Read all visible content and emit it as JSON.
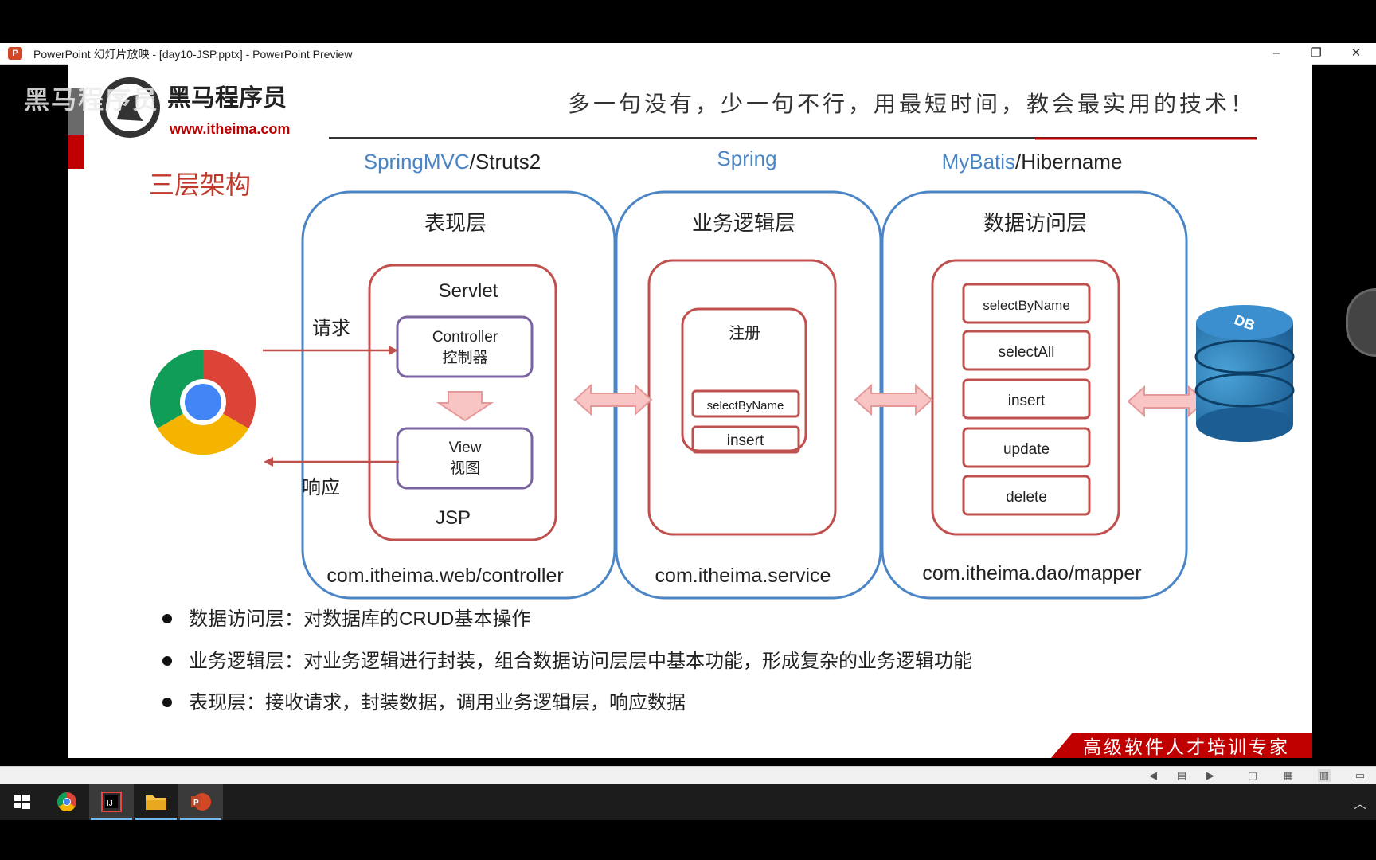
{
  "window": {
    "title": "PowerPoint 幻灯片放映 - [day10-JSP.pptx] - PowerPoint Preview",
    "app_icon_label": "P",
    "minimize": "–",
    "restore": "❐",
    "close": "✕"
  },
  "overlay": {
    "watermark": "黑马程序员"
  },
  "slide": {
    "logo": {
      "name": "黑马程序员",
      "url": "www.itheima.com"
    },
    "slogan": "多一句没有，少一句不行，用最短时间，教会最实用的技术！",
    "title": "三层架构",
    "frameworks": {
      "presentation": {
        "accent": "SpringMVC",
        "rest": "/Struts2"
      },
      "business": {
        "accent": "Spring",
        "rest": ""
      },
      "data": {
        "accent": "MyBatis",
        "rest": "/Hibername"
      }
    },
    "layers": {
      "presentation": {
        "title": "表现层",
        "servlet": "Servlet",
        "controller_en": "Controller",
        "controller_cn": "控制器",
        "view_en": "View",
        "view_cn": "视图",
        "jsp": "JSP",
        "package": "com.itheima.web/controller"
      },
      "business": {
        "title": "业务逻辑层",
        "register": "注册",
        "methods": [
          "selectByName",
          "insert"
        ],
        "package": "com.itheima.service"
      },
      "data": {
        "title": "数据访问层",
        "methods": [
          "selectByName",
          "selectAll",
          "insert",
          "update",
          "delete"
        ],
        "package": "com.itheima.dao/mapper"
      }
    },
    "request_label": "请求",
    "response_label": "响应",
    "db_label": "DB",
    "bullets": [
      "数据访问层：对数据库的CRUD基本操作",
      "业务逻辑层：对业务逻辑进行封装，组合数据访问层层中基本功能，形成复杂的业务逻辑功能",
      "表现层：接收请求，封装数据，调用业务逻辑层，响应数据"
    ],
    "footer_banner": "高级软件人才培训专家",
    "colors": {
      "accent_blue": "#4a86c5",
      "box_red": "#c0504d",
      "inner_purple": "#7a64a0",
      "title_red": "#c0392b"
    }
  },
  "statusbar": {
    "icons": [
      "prev-icon",
      "notes-icon",
      "next-icon",
      "normal-view-icon",
      "slide-sorter-icon",
      "reading-view-icon",
      "slideshow-icon"
    ]
  },
  "taskbar": {
    "apps": [
      "start-button",
      "chrome-app",
      "intellij-app",
      "file-explorer-app",
      "powerpoint-app"
    ],
    "tray_chevron": "︿"
  }
}
